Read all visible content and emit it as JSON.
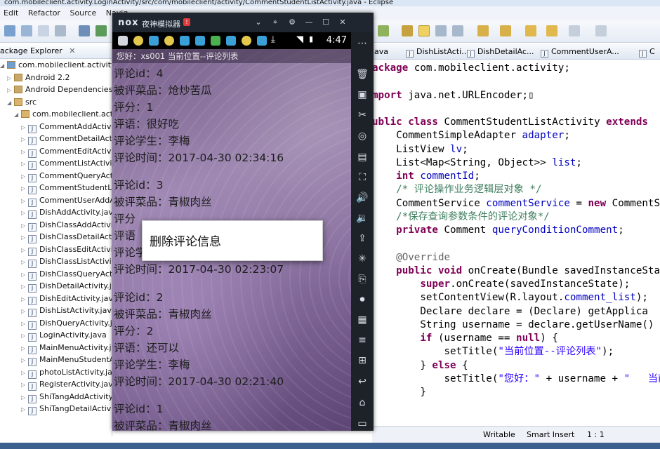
{
  "eclipse": {
    "title": "com.mobileclient.activity.LoginActivity/src/com/mobileclient/activity/CommentStudentListActivity.java - Eclipse",
    "menu": [
      "Edit",
      "Refactor",
      "Source",
      "Navig"
    ],
    "package_explorer": {
      "title": "ackage Explorer",
      "tree": [
        {
          "label": "com.mobileclient.activity.Logir",
          "kind": "project",
          "indent": 0
        },
        {
          "label": "Android 2.2",
          "kind": "lib",
          "indent": 1
        },
        {
          "label": "Android Dependencies",
          "kind": "lib",
          "indent": 1
        },
        {
          "label": "src",
          "kind": "folder",
          "indent": 1
        },
        {
          "label": "com.mobileclient.activit",
          "kind": "package",
          "indent": 2
        },
        {
          "label": "CommentAddActivit",
          "kind": "java",
          "indent": 3
        },
        {
          "label": "CommentDetailActiv",
          "kind": "java",
          "indent": 3
        },
        {
          "label": "CommentEditActivit",
          "kind": "java",
          "indent": 3
        },
        {
          "label": "CommentListActivity",
          "kind": "java",
          "indent": 3
        },
        {
          "label": "CommentQueryActiv",
          "kind": "java",
          "indent": 3
        },
        {
          "label": "CommentStudentLis",
          "kind": "java",
          "indent": 3
        },
        {
          "label": "CommentUserAddA",
          "kind": "java",
          "indent": 3
        },
        {
          "label": "DishAddActivity.java",
          "kind": "java",
          "indent": 3
        },
        {
          "label": "DishClassAddActivit",
          "kind": "java",
          "indent": 3
        },
        {
          "label": "DishClassDetailActiv",
          "kind": "java",
          "indent": 3
        },
        {
          "label": "DishClassEditActivity",
          "kind": "java",
          "indent": 3
        },
        {
          "label": "DishClassListActivity",
          "kind": "java",
          "indent": 3
        },
        {
          "label": "DishClassQueryActiv",
          "kind": "java",
          "indent": 3
        },
        {
          "label": "DishDetailActivity.jav",
          "kind": "java",
          "indent": 3
        },
        {
          "label": "DishEditActivity.java",
          "kind": "java",
          "indent": 3
        },
        {
          "label": "DishListActivity.java",
          "kind": "java",
          "indent": 3
        },
        {
          "label": "DishQueryActivity.ja",
          "kind": "java",
          "indent": 3
        },
        {
          "label": "LoginActivity.java",
          "kind": "java",
          "indent": 3
        },
        {
          "label": "MainMenuActivity.ja",
          "kind": "java",
          "indent": 3
        },
        {
          "label": "MainMenuStudentA",
          "kind": "java",
          "indent": 3
        },
        {
          "label": "photoListActivity.jav",
          "kind": "java",
          "indent": 3
        },
        {
          "label": "RegisterActivity.java",
          "kind": "java",
          "indent": 3
        },
        {
          "label": "ShiTangAddActivity.",
          "kind": "java",
          "indent": 3
        },
        {
          "label": "ShiTangDetailActivit",
          "kind": "java",
          "indent": 3
        }
      ]
    },
    "editor_tabs": [
      "java",
      "DishListActi...",
      "DishDetailAc...",
      "CommentUserA...",
      "C"
    ],
    "code_lines": [
      [
        {
          "t": "ackage",
          "c": "kw"
        },
        {
          "t": " com.mobileclient.activity;",
          "c": ""
        }
      ],
      [],
      [
        {
          "t": "mport",
          "c": "kw"
        },
        {
          "t": " java.net.URLEncoder;",
          "c": ""
        },
        {
          "t": "▯",
          "c": ""
        }
      ],
      [],
      [
        {
          "t": "ublic",
          "c": "kw"
        },
        {
          "t": " ",
          "c": ""
        },
        {
          "t": "class",
          "c": "kw"
        },
        {
          "t": " CommentStudentListActivity ",
          "c": ""
        },
        {
          "t": "extends",
          "c": "kw"
        }
      ],
      [
        {
          "t": "    CommentSimpleAdapter ",
          "c": ""
        },
        {
          "t": "adapter",
          "c": "fld"
        },
        {
          "t": ";",
          "c": ""
        }
      ],
      [
        {
          "t": "    ListView ",
          "c": ""
        },
        {
          "t": "lv",
          "c": "fld"
        },
        {
          "t": ";",
          "c": ""
        }
      ],
      [
        {
          "t": "    List<Map<String, Object>> ",
          "c": ""
        },
        {
          "t": "list",
          "c": "fld"
        },
        {
          "t": ";",
          "c": ""
        }
      ],
      [
        {
          "t": "    ",
          "c": ""
        },
        {
          "t": "int",
          "c": "kw"
        },
        {
          "t": " ",
          "c": ""
        },
        {
          "t": "commentId",
          "c": "fld"
        },
        {
          "t": ";",
          "c": ""
        }
      ],
      [
        {
          "t": "    /* 评论操作业务逻辑层对象 */",
          "c": "cm"
        }
      ],
      [
        {
          "t": "    CommentService ",
          "c": ""
        },
        {
          "t": "commentService",
          "c": "fld"
        },
        {
          "t": " = ",
          "c": ""
        },
        {
          "t": "new",
          "c": "kw"
        },
        {
          "t": " CommentS",
          "c": ""
        }
      ],
      [
        {
          "t": "    /*保存查询参数条件的评论对象*/",
          "c": "cm"
        }
      ],
      [
        {
          "t": "    ",
          "c": ""
        },
        {
          "t": "private",
          "c": "kw"
        },
        {
          "t": " Comment ",
          "c": ""
        },
        {
          "t": "queryConditionComment",
          "c": "fld"
        },
        {
          "t": ";",
          "c": ""
        }
      ],
      [],
      [
        {
          "t": "    @Override",
          "c": "an"
        }
      ],
      [
        {
          "t": "    ",
          "c": ""
        },
        {
          "t": "public",
          "c": "kw"
        },
        {
          "t": " ",
          "c": ""
        },
        {
          "t": "void",
          "c": "kw"
        },
        {
          "t": " onCreate(Bundle savedInstanceSta",
          "c": ""
        }
      ],
      [
        {
          "t": "        ",
          "c": ""
        },
        {
          "t": "super",
          "c": "kw"
        },
        {
          "t": ".onCreate(savedInstanceState);",
          "c": ""
        }
      ],
      [
        {
          "t": "        setContentView(R.layout.",
          "c": ""
        },
        {
          "t": "comment_list",
          "c": "fld"
        },
        {
          "t": ");",
          "c": ""
        }
      ],
      [
        {
          "t": "        Declare declare = (Declare) getApplica",
          "c": ""
        }
      ],
      [
        {
          "t": "        String username = declare.getUserName()",
          "c": ""
        }
      ],
      [
        {
          "t": "        ",
          "c": ""
        },
        {
          "t": "if",
          "c": "kw"
        },
        {
          "t": " (username == ",
          "c": ""
        },
        {
          "t": "null",
          "c": "kw"
        },
        {
          "t": ") {",
          "c": ""
        }
      ],
      [
        {
          "t": "            setTitle(",
          "c": ""
        },
        {
          "t": "\"当前位置--评论列表\"",
          "c": "st"
        },
        {
          "t": ");",
          "c": ""
        }
      ],
      [
        {
          "t": "        } ",
          "c": ""
        },
        {
          "t": "else",
          "c": "kw"
        },
        {
          "t": " {",
          "c": ""
        }
      ],
      [
        {
          "t": "            setTitle(",
          "c": ""
        },
        {
          "t": "\"您好：\"",
          "c": "st"
        },
        {
          "t": " + username + ",
          "c": ""
        },
        {
          "t": "\"   当前",
          "c": "st"
        }
      ],
      [
        {
          "t": "        }",
          "c": ""
        }
      ]
    ],
    "status": {
      "writable": "Writable",
      "insert": "Smart Insert",
      "position": "1 : 1"
    }
  },
  "emulator": {
    "logo": "nox",
    "name": "夜神模拟器",
    "badge": "!",
    "clock": "4:47",
    "app_title": "您好：xs001   当前位置--评论列表",
    "comments": [
      {
        "id": "评论id：4",
        "dish": "被评菜品：炝炒苦瓜",
        "score": "评分：1",
        "text": "评语：很好吃",
        "student": "评论学生：李梅",
        "time": "评论时间：2017-04-30 02:34:16"
      },
      {
        "id": "评论id：3",
        "dish": "被评菜品：青椒肉丝",
        "score": "评分",
        "text": "评语",
        "student": "评论学",
        "time": "评论时间：2017-04-30 02:23:07"
      },
      {
        "id": "评论id：2",
        "dish": "被评菜品：青椒肉丝",
        "score": "评分：2",
        "text": "评语：还可以",
        "student": "评论学生：李梅",
        "time": "评论时间：2017-04-30 02:21:40"
      },
      {
        "id": "评论id：1",
        "dish": "被评菜品：青椒肉丝"
      }
    ],
    "dialog": {
      "item": "删除评论信息"
    }
  }
}
